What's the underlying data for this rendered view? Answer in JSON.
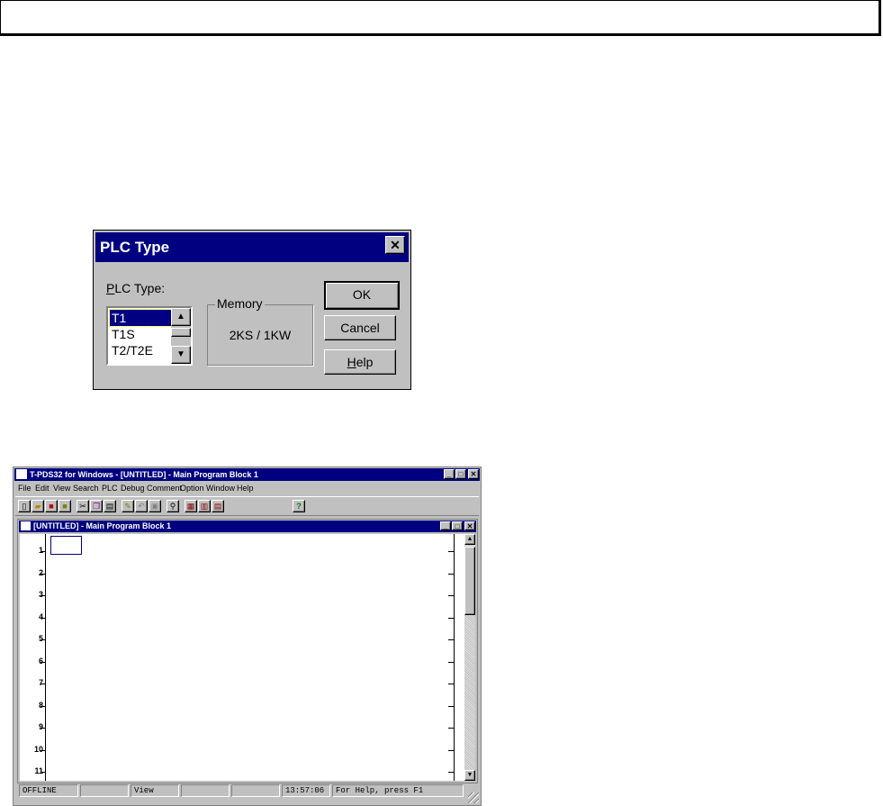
{
  "dialog": {
    "title": "PLC Type",
    "plc_type_label_u": "P",
    "plc_type_label_rest": "LC Type:",
    "list_items": [
      "T1",
      "T1S",
      "T2/T2E"
    ],
    "selected_item": "T1",
    "memory_label": "Memory",
    "memory_value": "2KS / 1KW",
    "ok": "OK",
    "cancel": "Cancel",
    "help_u": "H",
    "help_rest": "elp"
  },
  "app": {
    "title": "T-PDS32 for Windows - [UNTITLED] - Main Program Block 1",
    "menu": [
      "File",
      "Edit",
      "View",
      "Search",
      "PLC",
      "Debug",
      "Comment",
      "Option",
      "Window",
      "Help"
    ],
    "doc_title": "[UNTITLED] - Main Program Block 1",
    "rungs": [
      "1",
      "2",
      "3",
      "4",
      "5",
      "6",
      "7",
      "8",
      "9",
      "10",
      "11"
    ],
    "status": {
      "mode": "OFFLINE",
      "view": "View",
      "time": "13:57:06",
      "help": "For Help, press F1"
    }
  }
}
